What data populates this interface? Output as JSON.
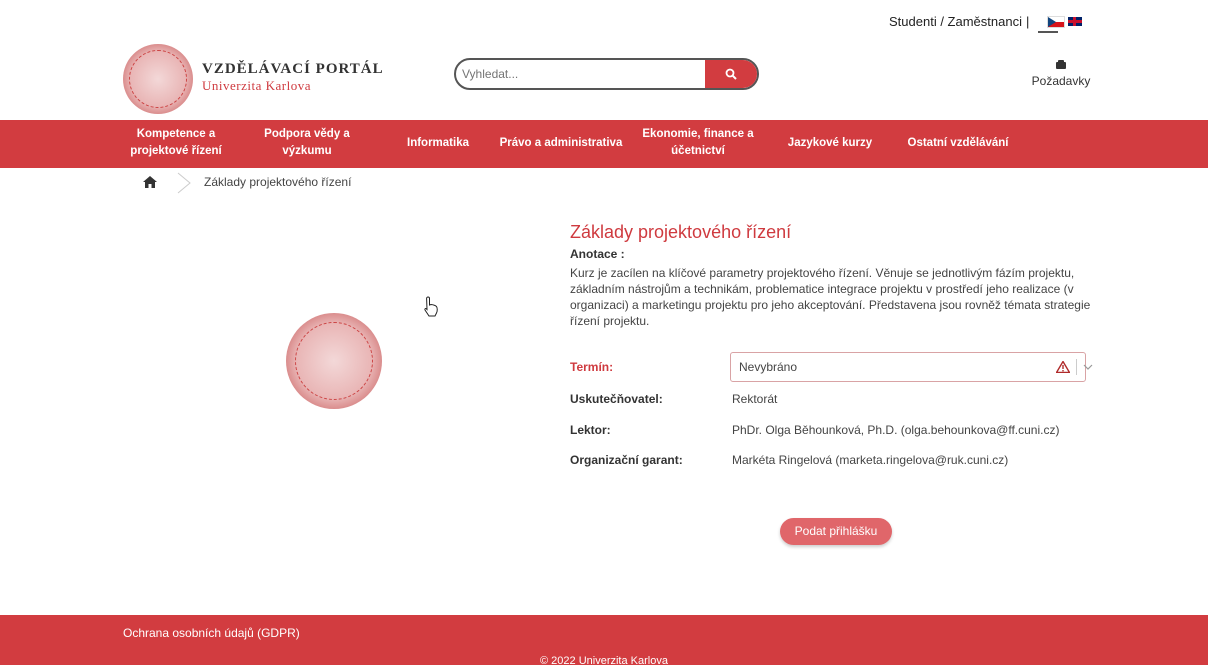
{
  "top": {
    "links": "Studenti / Zaměstnanci",
    "separator": "|",
    "lang_cz": "Čeština",
    "lang_en": "English"
  },
  "header": {
    "brand_title": "VZDĚLÁVACÍ PORTÁL",
    "brand_subtitle": "Univerzita Karlova",
    "search_placeholder": "Vyhledat...",
    "requests_label": "Požadavky"
  },
  "nav": {
    "items": [
      {
        "label": "Kompetence a projektové řízení"
      },
      {
        "label": "Podpora vědy a výzkumu"
      },
      {
        "label": "Informatika"
      },
      {
        "label": "Právo a administrativa"
      },
      {
        "label": "Ekonomie, finance a účetnictví"
      },
      {
        "label": "Jazykové kurzy"
      },
      {
        "label": "Ostatní vzdělávání"
      }
    ]
  },
  "breadcrumb": {
    "current": "Základy projektového řízení"
  },
  "course": {
    "title": "Základy projektového řízení",
    "annotation_label": "Anotace :",
    "annotation_text": "Kurz je zacílen na klíčové parametry projektového řízení. Věnuje se jednotlivým fázím projektu, základním nástrojům a technikám, problematice integrace projektu v prostředí jeho realizace (v organizaci) a marketingu projektu pro jeho akceptování. Představena jsou rovněž témata strategie řízení projektu.",
    "term_label": "Termín:",
    "term_value": "Nevybráno",
    "provider_label": "Uskutečňovatel:",
    "provider_value": "Rektorát",
    "lector_label": "Lektor:",
    "lector_value": "PhDr. Olga Běhounková, Ph.D. (olga.behounkova@ff.cuni.cz)",
    "guarantor_label": "Organizační garant:",
    "guarantor_value": "Markéta Ringelová (marketa.ringelova@ruk.cuni.cz)",
    "submit_label": "Podat přihlášku"
  },
  "footer": {
    "gdpr_link": "Ochrana osobních údajů (GDPR)",
    "copyright": "© 2022 Univerzita Karlova"
  },
  "colors": {
    "brand_red": "#d23c40",
    "title_red": "#cf3a3f",
    "button_pink": "#e0666a"
  }
}
